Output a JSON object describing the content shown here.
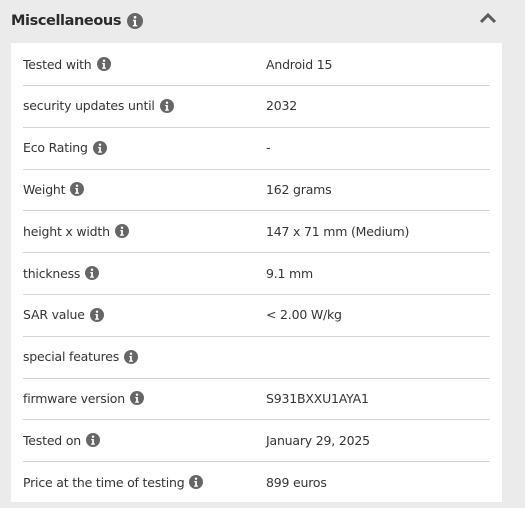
{
  "section": {
    "title": "Miscellaneous",
    "info_icon": "info-circle-icon",
    "collapse_icon": "chevron-up-icon",
    "expanded": true
  },
  "colors": {
    "page_background": "#ebebeb",
    "panel_background": "#ffffff",
    "icon": "#666666",
    "divider": "#d4d4d4",
    "text": "#333333"
  },
  "rows": [
    {
      "label": "Tested with",
      "value": "Android 15"
    },
    {
      "label": "security updates until",
      "value": "2032"
    },
    {
      "label": "Eco Rating",
      "value": "-"
    },
    {
      "label": "Weight",
      "value": "162 grams"
    },
    {
      "label": "height x width",
      "value": "147 x 71 mm (Medium)"
    },
    {
      "label": "thickness",
      "value": "9.1 mm"
    },
    {
      "label": "SAR value",
      "value": "< 2.00 W/kg"
    },
    {
      "label": "special features",
      "value": ""
    },
    {
      "label": "firmware version",
      "value": "S931BXXU1AYA1"
    },
    {
      "label": "Tested on",
      "value": "January 29, 2025"
    },
    {
      "label": "Price at the time of testing",
      "value": "899 euros"
    }
  ]
}
